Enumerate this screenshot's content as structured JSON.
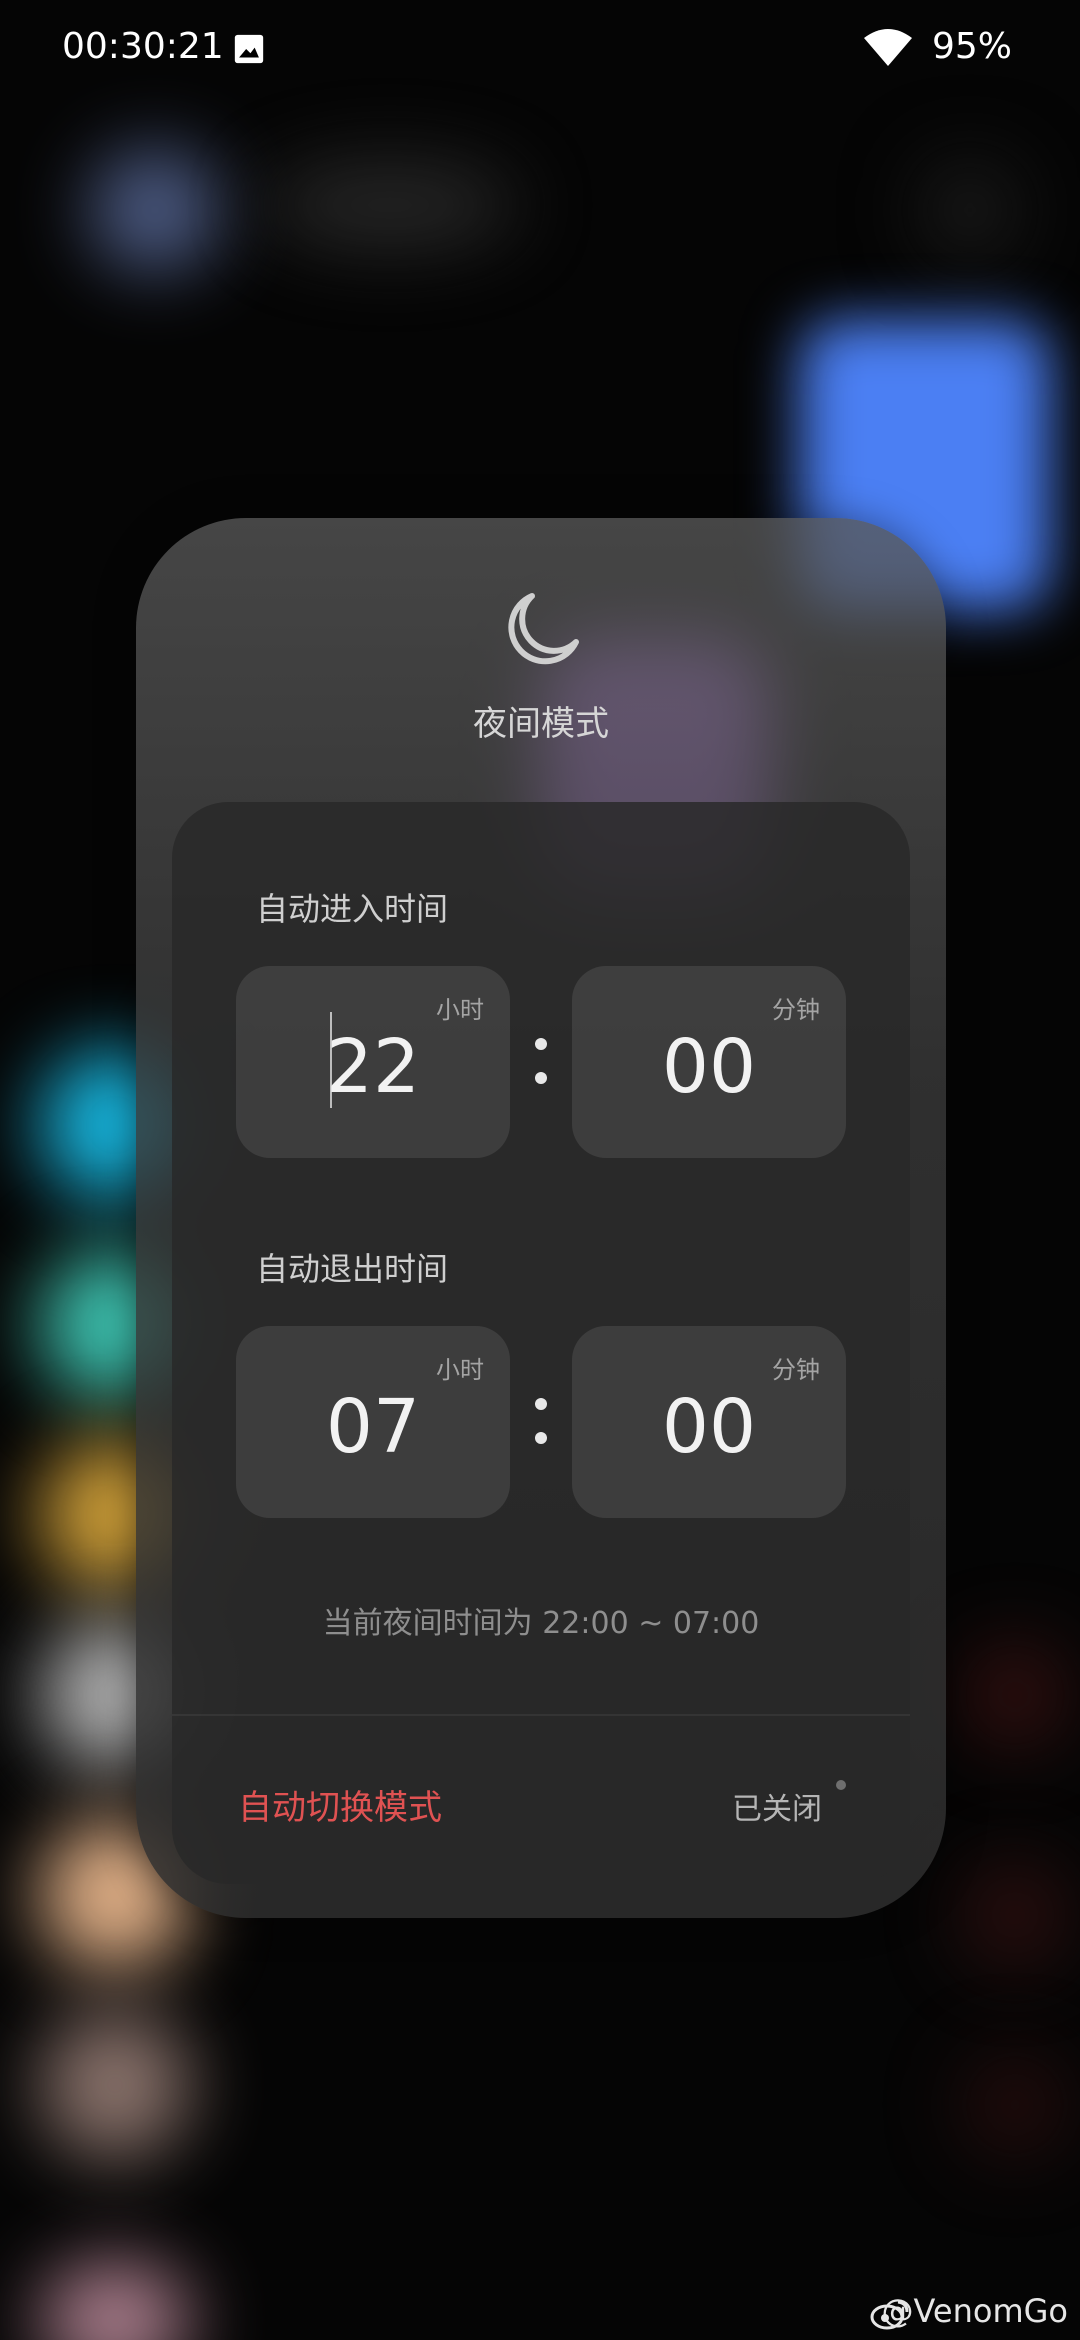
{
  "status_bar": {
    "time": "00:30:21",
    "battery": "95%",
    "icons": [
      "image-notification-icon",
      "wifi-icon"
    ]
  },
  "dialog": {
    "icon": "moon-icon",
    "title": "夜间模式",
    "enter": {
      "label": "自动进入时间",
      "hour": "22",
      "hour_unit": "小时",
      "minute": "00",
      "minute_unit": "分钟"
    },
    "exit": {
      "label": "自动退出时间",
      "hour": "07",
      "hour_unit": "小时",
      "minute": "00",
      "minute_unit": "分钟"
    },
    "summary": "当前夜间时间为 22:00 ~ 07:00",
    "auto_switch": {
      "label": "自动切换模式",
      "status": "已关闭"
    }
  },
  "watermark": "@VenomGo",
  "colors": {
    "accent_red": "#e05252",
    "text_primary": "#f2f2f2",
    "text_secondary": "#a4a4a4"
  }
}
